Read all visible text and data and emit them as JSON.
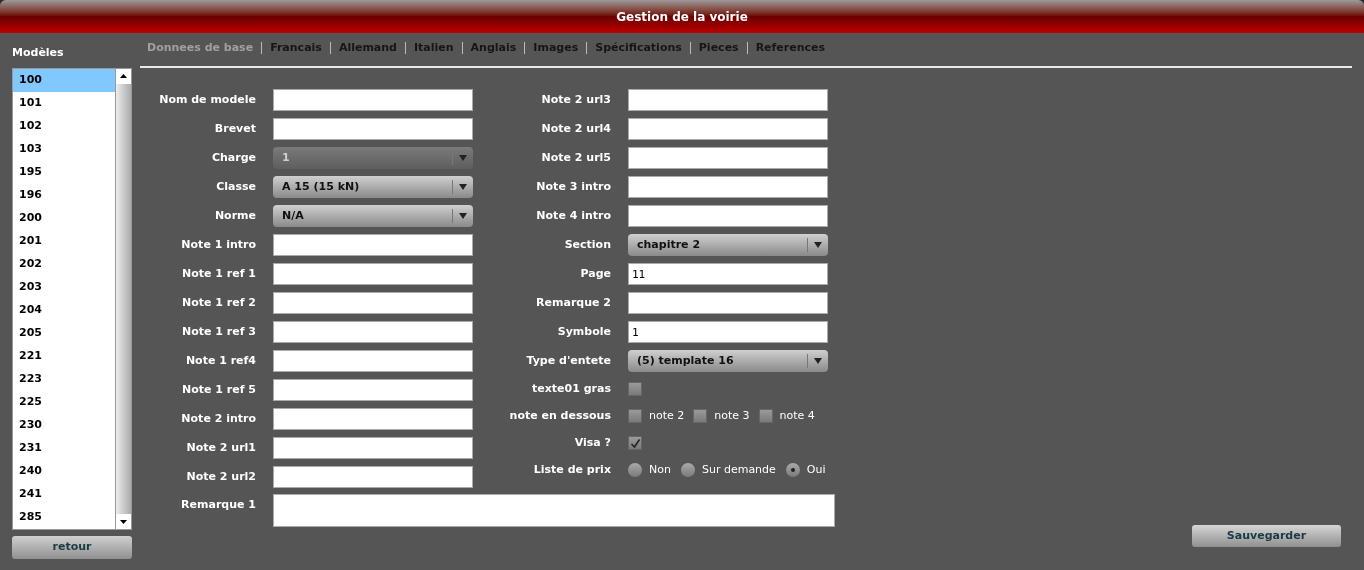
{
  "window": {
    "title": "Gestion de la voirie"
  },
  "sidebar": {
    "title": "Modèles",
    "items": [
      {
        "label": "100",
        "selected": true
      },
      {
        "label": "101",
        "selected": false
      },
      {
        "label": "102",
        "selected": false
      },
      {
        "label": "103",
        "selected": false
      },
      {
        "label": "195",
        "selected": false
      },
      {
        "label": "196",
        "selected": false
      },
      {
        "label": "200",
        "selected": false
      },
      {
        "label": "201",
        "selected": false
      },
      {
        "label": "202",
        "selected": false
      },
      {
        "label": "203",
        "selected": false
      },
      {
        "label": "204",
        "selected": false
      },
      {
        "label": "205",
        "selected": false
      },
      {
        "label": "221",
        "selected": false
      },
      {
        "label": "223",
        "selected": false
      },
      {
        "label": "225",
        "selected": false
      },
      {
        "label": "230",
        "selected": false
      },
      {
        "label": "231",
        "selected": false
      },
      {
        "label": "240",
        "selected": false
      },
      {
        "label": "241",
        "selected": false
      },
      {
        "label": "285",
        "selected": false
      }
    ],
    "button": "retour"
  },
  "tabs": [
    {
      "label": "Donnees de base",
      "selected": true
    },
    {
      "label": "Francais",
      "selected": false
    },
    {
      "label": "Allemand",
      "selected": false
    },
    {
      "label": "Italien",
      "selected": false
    },
    {
      "label": "Anglais",
      "selected": false
    },
    {
      "label": "Images",
      "selected": false
    },
    {
      "label": "Spécifications",
      "selected": false
    },
    {
      "label": "Pieces",
      "selected": false
    },
    {
      "label": "References",
      "selected": false
    }
  ],
  "form_left": [
    {
      "kind": "text",
      "label": "Nom de modele"
    },
    {
      "kind": "text",
      "label": "Brevet"
    },
    {
      "kind": "select",
      "label": "Charge",
      "value": "1",
      "disabled": true
    },
    {
      "kind": "select",
      "label": "Classe",
      "value": "A 15 (15 kN)",
      "disabled": false
    },
    {
      "kind": "select",
      "label": "Norme",
      "value": "N/A",
      "disabled": false
    },
    {
      "kind": "text",
      "label": "Note 1 intro"
    },
    {
      "kind": "text",
      "label": "Note 1 ref 1"
    },
    {
      "kind": "text",
      "label": "Note 1 ref 2"
    },
    {
      "kind": "text",
      "label": "Note 1 ref 3"
    },
    {
      "kind": "text",
      "label": "Note 1 ref4"
    },
    {
      "kind": "text",
      "label": "Note 1 ref 5"
    },
    {
      "kind": "text",
      "label": "Note 2 intro"
    },
    {
      "kind": "text",
      "label": "Note 2 url1"
    },
    {
      "kind": "text",
      "label": "Note 2 url2"
    }
  ],
  "form_right": [
    {
      "kind": "text",
      "label": "Note 2 url3"
    },
    {
      "kind": "text",
      "label": "Note 2 url4"
    },
    {
      "kind": "text",
      "label": "Note 2 url5"
    },
    {
      "kind": "text",
      "label": "Note 3 intro"
    },
    {
      "kind": "text",
      "label": "Note 4 intro"
    },
    {
      "kind": "select",
      "label": "Section",
      "value": "chapitre 2",
      "disabled": false
    },
    {
      "kind": "text",
      "label": "Page",
      "value": "11"
    },
    {
      "kind": "text",
      "label": "Remarque 2"
    },
    {
      "kind": "text",
      "label": "Symbole",
      "value": "1"
    },
    {
      "kind": "select",
      "label": "Type d'entete",
      "value": "(5) template 16",
      "disabled": false
    },
    {
      "kind": "checkboxes",
      "label": "texte01 gras",
      "options": [
        {
          "checked": false
        }
      ]
    },
    {
      "kind": "checkboxes",
      "label": "note en dessous",
      "options": [
        {
          "label": "note 2",
          "checked": false
        },
        {
          "label": "note 3",
          "checked": false
        },
        {
          "label": "note 4",
          "checked": false
        }
      ]
    },
    {
      "kind": "checkboxes",
      "label": "Visa ?",
      "options": [
        {
          "checked": true
        }
      ]
    },
    {
      "kind": "radios",
      "label": "Liste de prix",
      "options": [
        {
          "label": "Non",
          "selected": false
        },
        {
          "label": "Sur demande",
          "selected": false
        },
        {
          "label": "Oui",
          "selected": true
        }
      ]
    }
  ],
  "remark": {
    "label": "Remarque 1"
  },
  "save_button": "Sauvegarder"
}
